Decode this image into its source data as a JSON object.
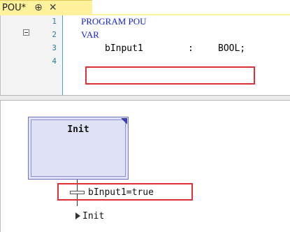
{
  "tab": {
    "title": "POU*",
    "pin_icon": "pin-icon",
    "close_icon": "close-icon"
  },
  "code": {
    "lines": [
      {
        "number": "1",
        "text": "PROGRAM POU"
      },
      {
        "number": "2",
        "text": "VAR"
      },
      {
        "number": "3",
        "ident": "bInput1",
        "colon": ":",
        "type": "BOOL;"
      },
      {
        "number": "4",
        "text": ""
      }
    ]
  },
  "sfc": {
    "step_name": "Init",
    "transition_condition": "bInput1=true",
    "jump_target": "Init"
  },
  "colors": {
    "tab_accent": "#fff29d",
    "keyword": "#1525d8",
    "highlight": "#e13035",
    "step_fill": "#dfe2f5"
  }
}
